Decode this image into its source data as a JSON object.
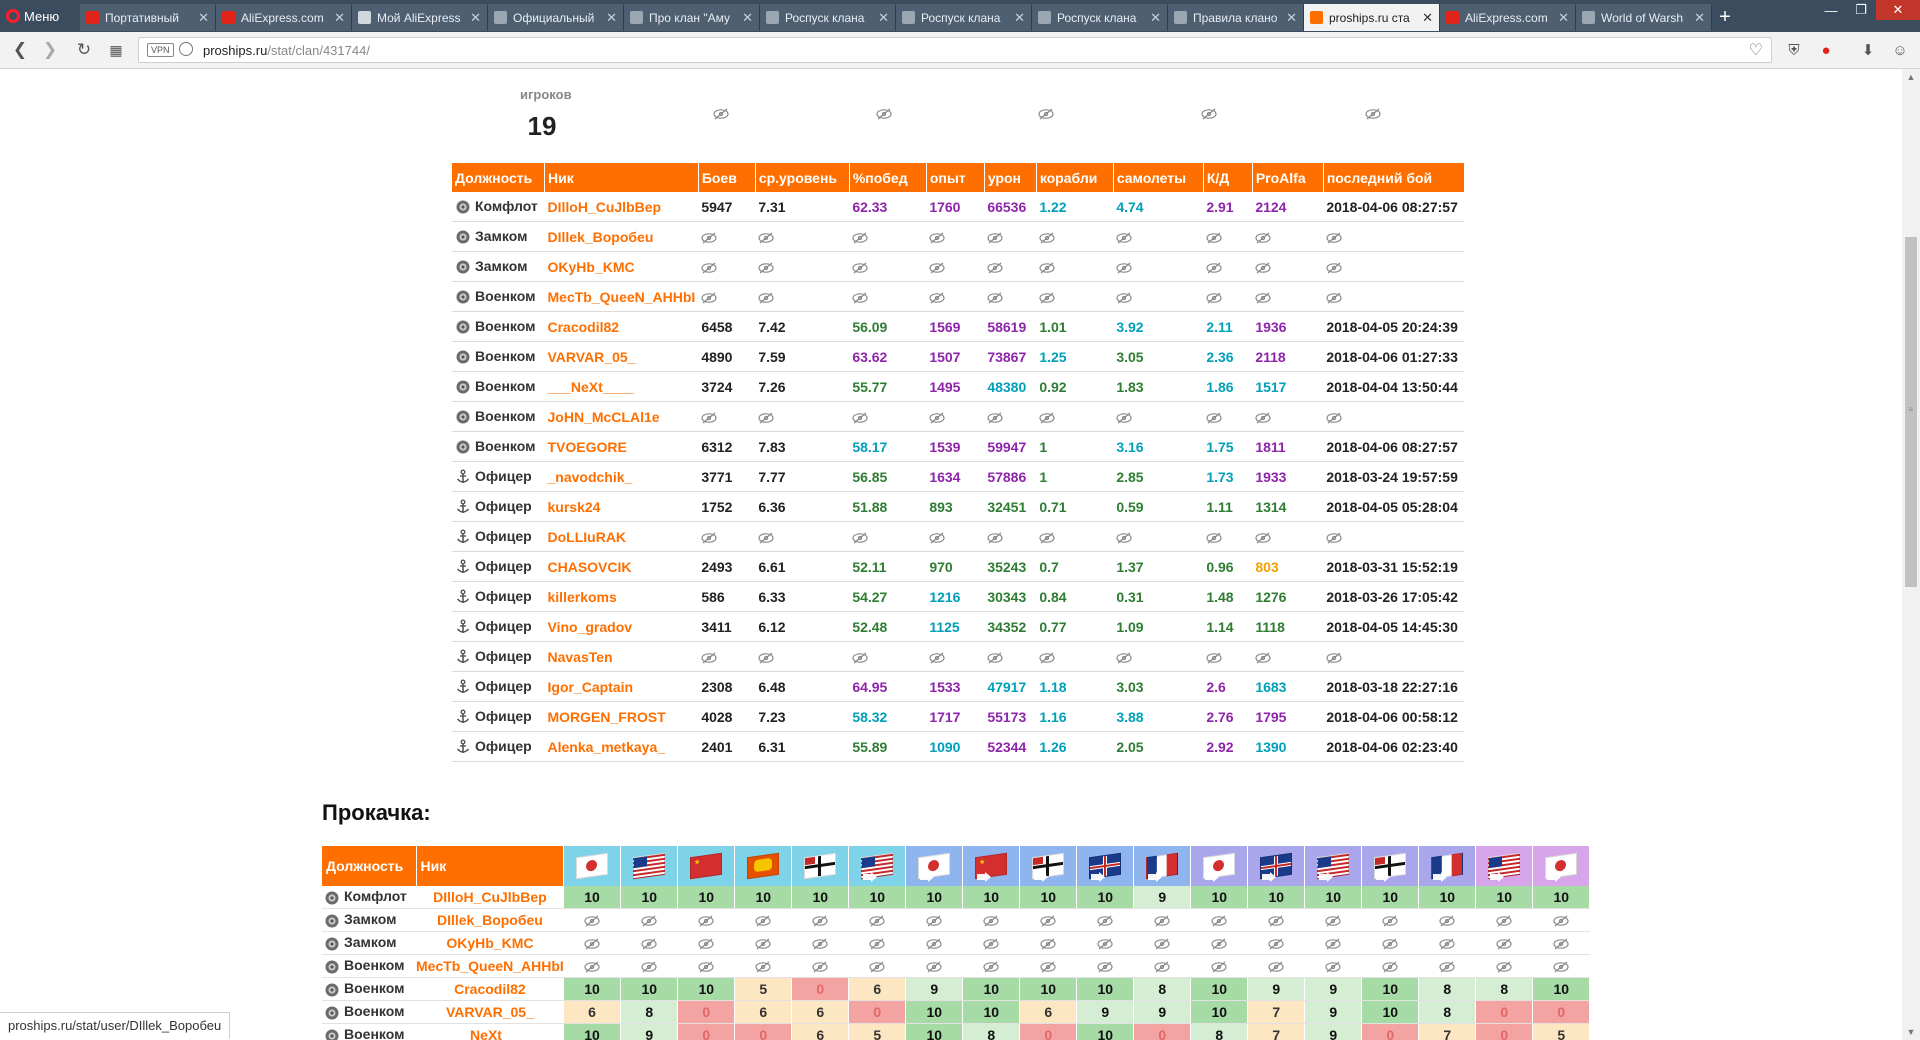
{
  "browser": {
    "menu_label": "Меню",
    "tabs": [
      {
        "title": "Портативный",
        "fav": "#e2231a"
      },
      {
        "title": "AliExpress.com",
        "fav": "#e2231a"
      },
      {
        "title": "Мой AliExpress",
        "fav": "#cfd6dc"
      },
      {
        "title": "Официальный",
        "fav": "#9aa7b3"
      },
      {
        "title": "Про клан \"Аму",
        "fav": "#9aa7b3"
      },
      {
        "title": "Роспуск клана",
        "fav": "#9aa7b3"
      },
      {
        "title": "Роспуск клана",
        "fav": "#9aa7b3"
      },
      {
        "title": "Роспуск клана",
        "fav": "#9aa7b3"
      },
      {
        "title": "Правила клано",
        "fav": "#9aa7b3"
      },
      {
        "title": "proships.ru ста",
        "fav": "#ff6f00"
      },
      {
        "title": "AliExpress.com",
        "fav": "#e2231a"
      },
      {
        "title": "World of Warsh",
        "fav": "#9aa7b3"
      }
    ],
    "active_tab": 9,
    "url_host": "proships.ru",
    "url_path": "/stat/clan/431744/",
    "vpn_label": "VPN"
  },
  "summary": {
    "label": "игроков",
    "value": "19"
  },
  "roster": {
    "headers": [
      "Должность",
      "Ник",
      "Боев",
      "ср.уровень",
      "%побед",
      "опыт",
      "урон",
      "корабли",
      "самолеты",
      "К/Д",
      "ProAlfa",
      "последний бой"
    ],
    "rows": [
      {
        "rank": "Комфлот",
        "nick": "DIlloH_CuJlbBep",
        "hidden": false,
        "battles": "5947",
        "avg": "7.31",
        "win": "62.33",
        "win_c": "purple",
        "exp": "1760",
        "exp_c": "purple",
        "dmg": "66536",
        "dmg_c": "purple",
        "ships": "1.22",
        "ships_c": "cyan",
        "planes": "4.74",
        "planes_c": "cyan",
        "kd": "2.91",
        "kd_c": "purple",
        "pa": "2124",
        "pa_c": "purple",
        "last": "2018-04-06 08:27:57"
      },
      {
        "rank": "Замком",
        "nick": "DIllek_Воробеu",
        "hidden": true
      },
      {
        "rank": "Замком",
        "nick": "OKyHb_KMC",
        "hidden": true
      },
      {
        "rank": "Военком",
        "nick": "MecTb_QueeN_AHHbI",
        "hidden": true
      },
      {
        "rank": "Военком",
        "nick": "Cracodil82",
        "hidden": false,
        "battles": "6458",
        "avg": "7.42",
        "win": "56.09",
        "win_c": "green",
        "exp": "1569",
        "exp_c": "purple",
        "dmg": "58619",
        "dmg_c": "purple",
        "ships": "1.01",
        "ships_c": "green",
        "planes": "3.92",
        "planes_c": "cyan",
        "kd": "2.11",
        "kd_c": "cyan",
        "pa": "1936",
        "pa_c": "purple",
        "last": "2018-04-05 20:24:39"
      },
      {
        "rank": "Военком",
        "nick": "VARVAR_05_",
        "hidden": false,
        "battles": "4890",
        "avg": "7.59",
        "win": "63.62",
        "win_c": "purple",
        "exp": "1507",
        "exp_c": "purple",
        "dmg": "73867",
        "dmg_c": "purple",
        "ships": "1.25",
        "ships_c": "cyan",
        "planes": "3.05",
        "planes_c": "green",
        "kd": "2.36",
        "kd_c": "cyan",
        "pa": "2118",
        "pa_c": "purple",
        "last": "2018-04-06 01:27:33"
      },
      {
        "rank": "Военком",
        "nick": "___NeXt____",
        "hidden": false,
        "battles": "3724",
        "avg": "7.26",
        "win": "55.77",
        "win_c": "green",
        "exp": "1495",
        "exp_c": "purple",
        "dmg": "48380",
        "dmg_c": "cyan",
        "ships": "0.92",
        "ships_c": "green",
        "planes": "1.83",
        "planes_c": "green",
        "kd": "1.86",
        "kd_c": "cyan",
        "pa": "1517",
        "pa_c": "cyan",
        "last": "2018-04-04 13:50:44"
      },
      {
        "rank": "Военком",
        "nick": "JoHN_McCLAl1e",
        "hidden": true
      },
      {
        "rank": "Военком",
        "nick": "TVOEGORE",
        "hidden": false,
        "battles": "6312",
        "avg": "7.83",
        "win": "58.17",
        "win_c": "cyan",
        "exp": "1539",
        "exp_c": "purple",
        "dmg": "59947",
        "dmg_c": "purple",
        "ships": "1",
        "ships_c": "green",
        "planes": "3.16",
        "planes_c": "cyan",
        "kd": "1.75",
        "kd_c": "cyan",
        "pa": "1811",
        "pa_c": "purple",
        "last": "2018-04-06 08:27:57"
      },
      {
        "rank": "Офицер",
        "nick": "_navodchik_",
        "hidden": false,
        "battles": "3771",
        "avg": "7.77",
        "win": "56.85",
        "win_c": "green",
        "exp": "1634",
        "exp_c": "purple",
        "dmg": "57886",
        "dmg_c": "purple",
        "ships": "1",
        "ships_c": "green",
        "planes": "2.85",
        "planes_c": "green",
        "kd": "1.73",
        "kd_c": "cyan",
        "pa": "1933",
        "pa_c": "purple",
        "last": "2018-03-24 19:57:59"
      },
      {
        "rank": "Офицер",
        "nick": "kursk24",
        "hidden": false,
        "battles": "1752",
        "avg": "6.36",
        "win": "51.88",
        "win_c": "green",
        "exp": "893",
        "exp_c": "green",
        "dmg": "32451",
        "dmg_c": "green",
        "ships": "0.71",
        "ships_c": "green",
        "planes": "0.59",
        "planes_c": "green",
        "kd": "1.11",
        "kd_c": "green",
        "pa": "1314",
        "pa_c": "green",
        "last": "2018-04-05 05:28:04"
      },
      {
        "rank": "Офицер",
        "nick": "DoLLIuRAK",
        "hidden": true
      },
      {
        "rank": "Офицер",
        "nick": "CHASOVCIK",
        "hidden": false,
        "battles": "2493",
        "avg": "6.61",
        "win": "52.11",
        "win_c": "green",
        "exp": "970",
        "exp_c": "green",
        "dmg": "35243",
        "dmg_c": "green",
        "ships": "0.7",
        "ships_c": "green",
        "planes": "1.37",
        "planes_c": "green",
        "kd": "0.96",
        "kd_c": "green",
        "pa": "803",
        "pa_c": "orange",
        "last": "2018-03-31 15:52:19"
      },
      {
        "rank": "Офицер",
        "nick": "killerkoms",
        "hidden": false,
        "battles": "586",
        "avg": "6.33",
        "win": "54.27",
        "win_c": "green",
        "exp": "1216",
        "exp_c": "cyan",
        "dmg": "30343",
        "dmg_c": "green",
        "ships": "0.84",
        "ships_c": "green",
        "planes": "0.31",
        "planes_c": "green",
        "kd": "1.48",
        "kd_c": "green",
        "pa": "1276",
        "pa_c": "green",
        "last": "2018-03-26 17:05:42"
      },
      {
        "rank": "Офицер",
        "nick": "Vino_gradov",
        "hidden": false,
        "battles": "3411",
        "avg": "6.12",
        "win": "52.48",
        "win_c": "green",
        "exp": "1125",
        "exp_c": "cyan",
        "dmg": "34352",
        "dmg_c": "green",
        "ships": "0.77",
        "ships_c": "green",
        "planes": "1.09",
        "planes_c": "green",
        "kd": "1.14",
        "kd_c": "green",
        "pa": "1118",
        "pa_c": "green",
        "last": "2018-04-05 14:45:30"
      },
      {
        "rank": "Офицер",
        "nick": "NavasTen",
        "hidden": true
      },
      {
        "rank": "Офицер",
        "nick": "Igor_Captain",
        "hidden": false,
        "battles": "2308",
        "avg": "6.48",
        "win": "64.95",
        "win_c": "purple",
        "exp": "1533",
        "exp_c": "purple",
        "dmg": "47917",
        "dmg_c": "cyan",
        "ships": "1.18",
        "ships_c": "cyan",
        "planes": "3.03",
        "planes_c": "green",
        "kd": "2.6",
        "kd_c": "purple",
        "pa": "1683",
        "pa_c": "cyan",
        "last": "2018-03-18 22:27:16"
      },
      {
        "rank": "Офицер",
        "nick": "MORGEN_FROST",
        "hidden": false,
        "battles": "4028",
        "avg": "7.23",
        "win": "58.32",
        "win_c": "cyan",
        "exp": "1717",
        "exp_c": "purple",
        "dmg": "55173",
        "dmg_c": "purple",
        "ships": "1.16",
        "ships_c": "cyan",
        "planes": "3.88",
        "planes_c": "cyan",
        "kd": "2.76",
        "kd_c": "purple",
        "pa": "1795",
        "pa_c": "purple",
        "last": "2018-04-06 00:58:12"
      },
      {
        "rank": "Офицер",
        "nick": "Alenka_metkaya_",
        "hidden": false,
        "battles": "2401",
        "avg": "6.31",
        "win": "55.89",
        "win_c": "green",
        "exp": "1090",
        "exp_c": "cyan",
        "dmg": "52344",
        "dmg_c": "purple",
        "ships": "1.26",
        "ships_c": "cyan",
        "planes": "2.05",
        "planes_c": "green",
        "kd": "2.92",
        "kd_c": "purple",
        "pa": "1390",
        "pa_c": "cyan",
        "last": "2018-04-06 02:23:40"
      }
    ]
  },
  "tier": {
    "title": "Прокачка:",
    "headers": [
      "Должность",
      "Ник"
    ],
    "flags": [
      {
        "nation": "japan",
        "bg": "#7fd3e8",
        "arrow": false
      },
      {
        "nation": "usa",
        "bg": "#7fd3e8",
        "arrow": false
      },
      {
        "nation": "ussr",
        "bg": "#7fd3e8",
        "arrow": false
      },
      {
        "nation": "panasia",
        "bg": "#7fd3e8",
        "arrow": false
      },
      {
        "nation": "germany",
        "bg": "#7fd3e8",
        "arrow": false
      },
      {
        "nation": "usa",
        "bg": "#7fd3e8",
        "arrow": true
      },
      {
        "nation": "japan",
        "bg": "#8fb5ef",
        "arrow": true
      },
      {
        "nation": "ussr",
        "bg": "#8fb5ef",
        "arrow": true
      },
      {
        "nation": "germany",
        "bg": "#8fb5ef",
        "arrow": true
      },
      {
        "nation": "uk",
        "bg": "#8fb5ef",
        "arrow": true
      },
      {
        "nation": "france",
        "bg": "#8fb5ef",
        "arrow": true
      },
      {
        "nation": "japan",
        "bg": "#aaa6ec",
        "arrow": true
      },
      {
        "nation": "uk",
        "bg": "#aaa6ec",
        "arrow": true
      },
      {
        "nation": "usa",
        "bg": "#aaa6ec",
        "arrow": true
      },
      {
        "nation": "germany",
        "bg": "#aaa6ec",
        "arrow": true
      },
      {
        "nation": "france",
        "bg": "#aaa6ec",
        "arrow": true
      },
      {
        "nation": "usa",
        "bg": "#d7a6ea",
        "arrow": true
      },
      {
        "nation": "japan",
        "bg": "#d7a6ea",
        "arrow": true
      }
    ],
    "rows": [
      {
        "rank": "Комфлот",
        "nick": "DIlloH_CuJlbBep",
        "hidden": false,
        "values": [
          "10",
          "10",
          "10",
          "10",
          "10",
          "10",
          "10",
          "10",
          "10",
          "10",
          "9",
          "10",
          "10",
          "10",
          "10",
          "10",
          "10",
          "10"
        ]
      },
      {
        "rank": "Замком",
        "nick": "DIllek_Воробеu",
        "hidden": true
      },
      {
        "rank": "Замком",
        "nick": "OKyHb_KMC",
        "hidden": true
      },
      {
        "rank": "Военком",
        "nick": "MecTb_QueeN_AHHbI",
        "hidden": true
      },
      {
        "rank": "Военком",
        "nick": "Cracodil82",
        "hidden": false,
        "values": [
          "10",
          "10",
          "10",
          "5",
          "0",
          "6",
          "9",
          "10",
          "10",
          "10",
          "8",
          "10",
          "9",
          "9",
          "10",
          "8",
          "8",
          "10"
        ]
      },
      {
        "rank": "Военком",
        "nick": "VARVAR_05_",
        "hidden": false,
        "values": [
          "6",
          "8",
          "0",
          "6",
          "6",
          "0",
          "10",
          "10",
          "6",
          "9",
          "9",
          "10",
          "7",
          "9",
          "10",
          "8",
          "0",
          "0"
        ]
      },
      {
        "rank": "Военком",
        "nick": "___NeXt____",
        "hidden": false,
        "values": [
          "10",
          "9",
          "0",
          "0",
          "6",
          "5",
          "10",
          "8",
          "0",
          "10",
          "0",
          "8",
          "7",
          "9",
          "0",
          "7",
          "0",
          "5"
        ]
      }
    ]
  },
  "status_url": "proships.ru/stat/user/DIllek_Воробеu"
}
